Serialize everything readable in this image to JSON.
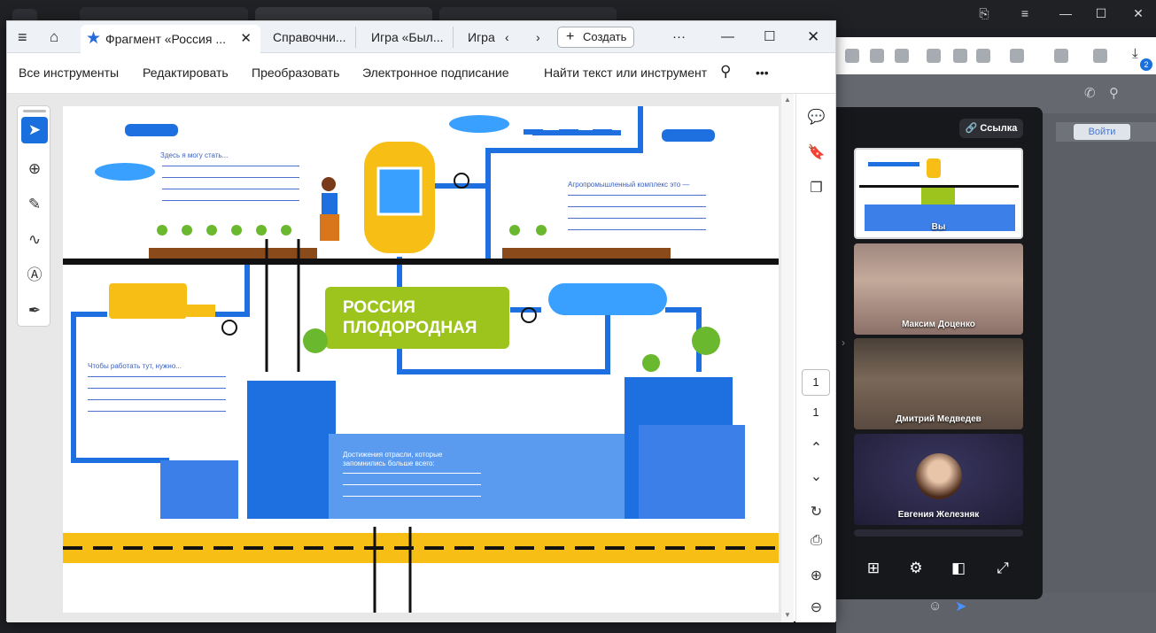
{
  "background": {
    "messenger_call": {
      "link_button": "Ссылка",
      "join_button": "Войти",
      "participants": [
        {
          "name": "Вы"
        },
        {
          "name": "Максим Доценко"
        },
        {
          "name": "Дмитрий Медведев"
        },
        {
          "name": "Евгения Железняк"
        }
      ],
      "notification_count": "2"
    }
  },
  "window": {
    "tabs": [
      {
        "label": "Фрагмент «Россия ...",
        "active": true
      },
      {
        "label": "Справочни..."
      },
      {
        "label": "Игра «Был..."
      },
      {
        "label": "Игра"
      }
    ],
    "create_button": "Создать",
    "more_label": "···"
  },
  "menu": {
    "items": [
      "Все инструменты",
      "Редактировать",
      "Преобразовать",
      "Электронное подписание"
    ],
    "search_label": "Найти текст или инструмент",
    "more": "•••"
  },
  "viewer": {
    "current_page": "1",
    "total_pages": "1"
  },
  "poster": {
    "text_can_become": "Здесь я могу стать...",
    "text_agro": "Агропромышленный комплекс это —",
    "text_work_here": "Чтобы работать тут, нужно...",
    "text_achievements": "Достижения отрасли, которые запомнились больше всего:",
    "badge_line1": "РОССИЯ",
    "badge_line2": "ПЛОДОРОДНАЯ",
    "colors": {
      "blue": "#1e6fe0",
      "yellow": "#f7be16",
      "green": "#9dc41c",
      "dark": "#111111"
    }
  }
}
